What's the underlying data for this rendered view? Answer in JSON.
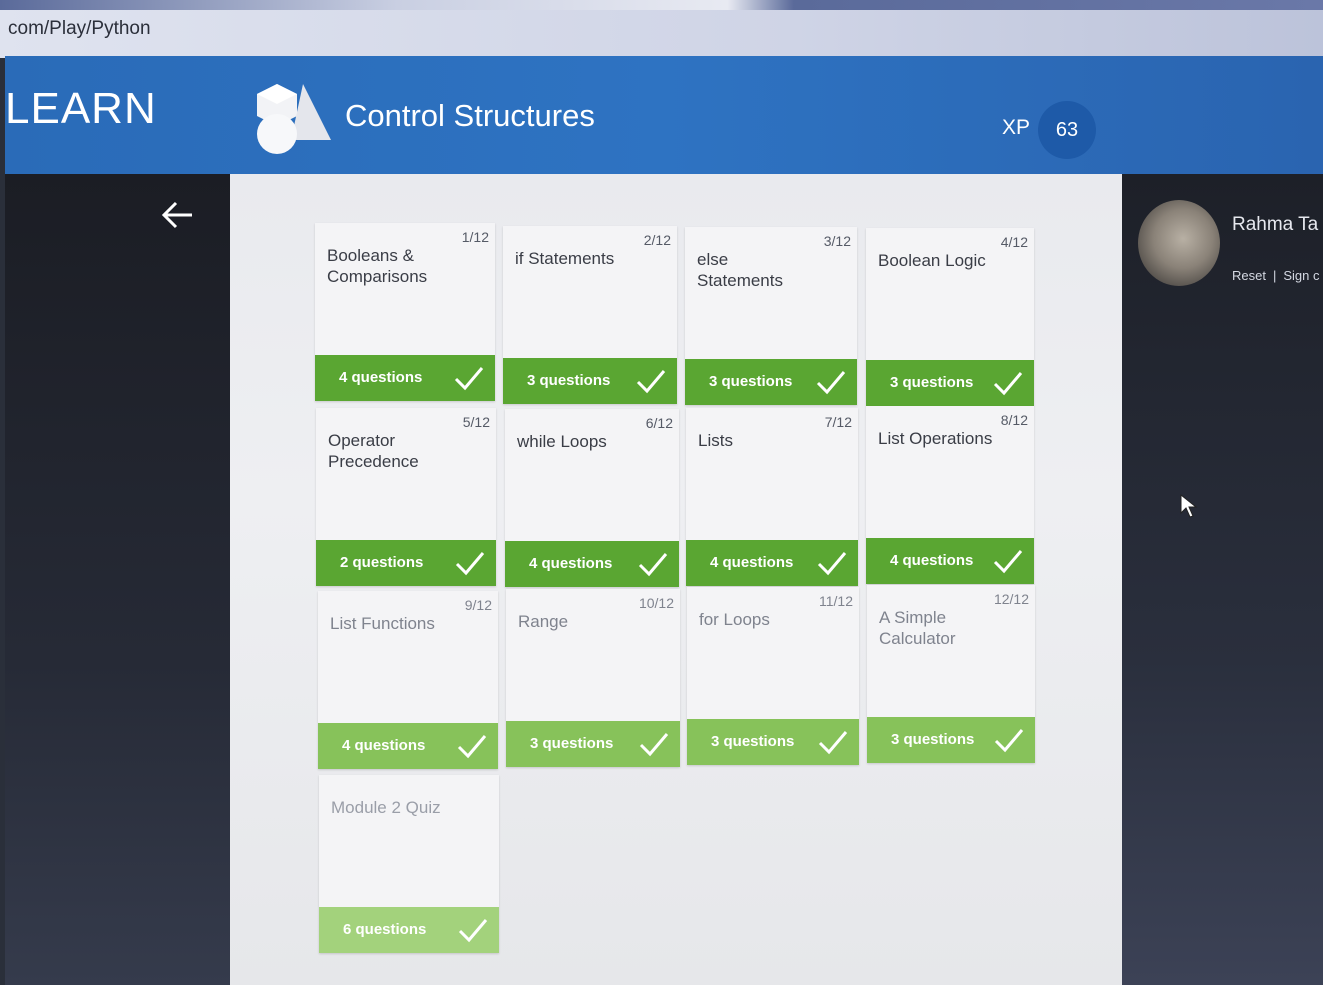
{
  "browser": {
    "url": "com/Play/Python"
  },
  "header": {
    "logo": "LEARN",
    "title": "Control Structures",
    "xp_label": "XP",
    "xp_value": "63"
  },
  "user": {
    "name": "Rahma Ta",
    "reset": "Reset",
    "sign": "Sign c"
  },
  "colors": {
    "header_blue": "#2e73c2",
    "complete_green": "#5aa632"
  },
  "lessons": [
    {
      "title": "Booleans & Comparisons",
      "progress": "1/12",
      "questions": "4 questions",
      "completed": true
    },
    {
      "title": "if Statements",
      "progress": "2/12",
      "questions": "3 questions",
      "completed": true
    },
    {
      "title": "else Statements",
      "progress": "3/12",
      "questions": "3 questions",
      "completed": true
    },
    {
      "title": "Boolean Logic",
      "progress": "4/12",
      "questions": "3 questions",
      "completed": true
    },
    {
      "title": "Operator Precedence",
      "progress": "5/12",
      "questions": "2 questions",
      "completed": true
    },
    {
      "title": "while Loops",
      "progress": "6/12",
      "questions": "4 questions",
      "completed": true
    },
    {
      "title": "Lists",
      "progress": "7/12",
      "questions": "4 questions",
      "completed": true
    },
    {
      "title": "List Operations",
      "progress": "8/12",
      "questions": "4 questions",
      "completed": true
    },
    {
      "title": "List Functions",
      "progress": "9/12",
      "questions": "4 questions",
      "completed": true
    },
    {
      "title": "Range",
      "progress": "10/12",
      "questions": "3 questions",
      "completed": true
    },
    {
      "title": "for Loops",
      "progress": "11/12",
      "questions": "3 questions",
      "completed": true
    },
    {
      "title": "A Simple Calculator",
      "progress": "12/12",
      "questions": "3 questions",
      "completed": true
    },
    {
      "title": "Module 2 Quiz",
      "progress": "",
      "questions": "6 questions",
      "completed": true
    }
  ]
}
